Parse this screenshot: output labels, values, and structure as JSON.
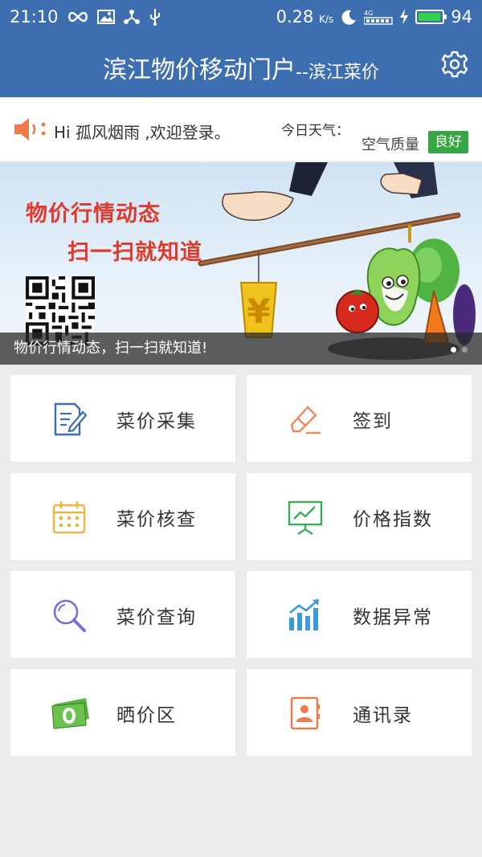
{
  "status_bar": {
    "time": "21:10",
    "network_speed": "0.28",
    "network_unit": "K/s",
    "network_type": "4G",
    "battery": "94",
    "battery_level": 0.94,
    "icons": [
      "infinity-icon",
      "image-icon",
      "share-icon",
      "usb-icon",
      "silent-icon",
      "signal-icon",
      "charging-icon",
      "battery-icon"
    ]
  },
  "header": {
    "title": "滨江物价移动门户",
    "subtitle": "--滨江菜价",
    "settings_icon": "gear-icon"
  },
  "greeting": {
    "message": "Hi 孤风烟雨 ,欢迎登录。",
    "weather_label": "今日天气：",
    "air_quality_label": "空气质量",
    "air_quality_value": "良好",
    "air_quality_color": "#35a843"
  },
  "banner": {
    "slogan_line1": "物价行情动态",
    "slogan_line2": "扫一扫就知道",
    "caption": "物价行情动态，扫一扫就知道!",
    "slide_count": 2,
    "active_slide": 1
  },
  "menu": [
    {
      "label": "菜价采集",
      "icon": "form-edit-icon",
      "color": "#3d6eb0"
    },
    {
      "label": "签到",
      "icon": "eraser-pen-icon",
      "color": "#ee8a5c"
    },
    {
      "label": "菜价核查",
      "icon": "calendar-icon",
      "color": "#f0b443"
    },
    {
      "label": "价格指数",
      "icon": "chart-board-icon",
      "color": "#3aad5a"
    },
    {
      "label": "菜价查询",
      "icon": "magnifier-icon",
      "color": "#7b6fd6"
    },
    {
      "label": "数据异常",
      "icon": "bar-trend-icon",
      "color": "#3a9ad8"
    },
    {
      "label": "晒价区",
      "icon": "money-icon",
      "color": "#5ab342"
    },
    {
      "label": "通讯录",
      "icon": "contacts-icon",
      "color": "#ee7b49"
    }
  ]
}
